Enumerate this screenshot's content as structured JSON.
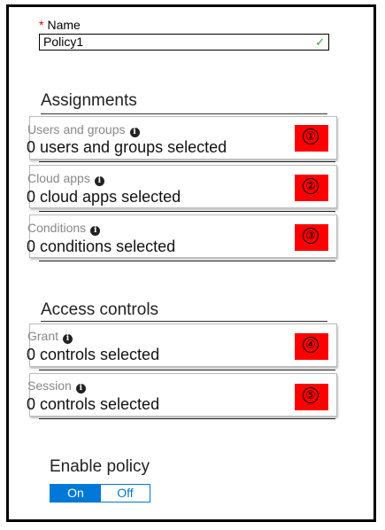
{
  "name_field": {
    "required_mark": "*",
    "label": "Name",
    "value": "Policy1"
  },
  "assignments": {
    "title": "Assignments",
    "items": [
      {
        "title": "Users and groups",
        "value": "0 users and groups selected",
        "badge": "①"
      },
      {
        "title": "Cloud apps",
        "value": "0 cloud apps selected",
        "badge": "②"
      },
      {
        "title": "Conditions",
        "value": "0 conditions selected",
        "badge": "③"
      }
    ]
  },
  "access_controls": {
    "title": "Access controls",
    "items": [
      {
        "title": "Grant",
        "value": "0 controls selected",
        "badge": "④"
      },
      {
        "title": "Session",
        "value": "0 controls selected",
        "badge": "⑤"
      }
    ]
  },
  "enable_policy": {
    "title": "Enable policy",
    "on_label": "On",
    "off_label": "Off",
    "selected": "On"
  },
  "colors": {
    "accent": "#0078d7",
    "badge": "#ff0000",
    "check": "#3aa23a",
    "required": "#e00000"
  }
}
